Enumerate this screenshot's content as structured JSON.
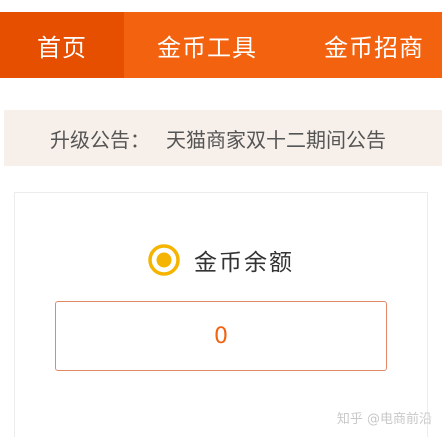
{
  "nav": {
    "items": [
      {
        "label": "首页",
        "active": true
      },
      {
        "label": "金币工具",
        "active": false
      },
      {
        "label": "金币招商",
        "active": false
      }
    ]
  },
  "notice": {
    "label": "升级公告：",
    "text": "天猫商家双十二期间公告"
  },
  "balance": {
    "title": "金币余额",
    "value": "0",
    "icon": "coin-icon"
  },
  "watermark": "知乎 @电商前沿",
  "colors": {
    "brand": "#f2620f",
    "nav_active": "#e64f00",
    "notice_bg": "#f7f0ea",
    "coin": "#f5b400"
  }
}
